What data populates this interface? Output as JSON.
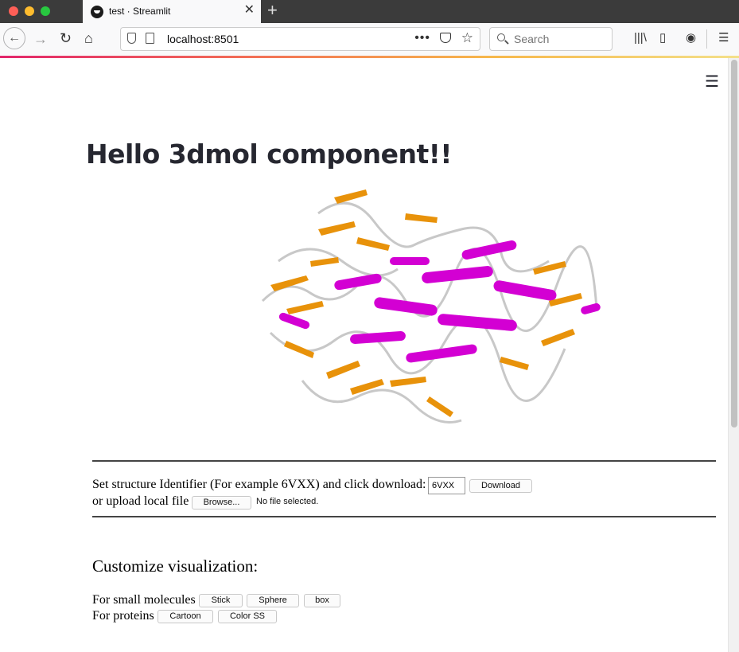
{
  "browser": {
    "tab_title": "test · Streamlit",
    "url": "localhost:8501",
    "search_placeholder": "Search",
    "more_label": "•••"
  },
  "page": {
    "title": "Hello 3dmol component!!",
    "structure_prompt": "Set structure Identifier (For example 6VXX) and click download:",
    "structure_value": "6VXX",
    "download_label": "Download",
    "upload_prompt": "or upload local file",
    "browse_label": "Browse...",
    "file_status": "No file selected.",
    "customize_heading": "Customize visualization:",
    "small_molecules_label": "For small molecules",
    "stick_label": "Stick",
    "sphere_label": "Sphere",
    "box_label": "box",
    "proteins_label": "For proteins",
    "cartoon_label": "Cartoon",
    "color_ss_label": "Color SS"
  },
  "colors": {
    "strand": "#e8920a",
    "helix": "#d300d3",
    "coil": "#c8c8c8"
  }
}
